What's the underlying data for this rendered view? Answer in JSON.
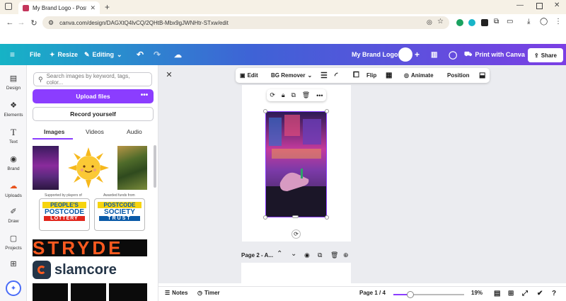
{
  "browser": {
    "tab_title": "My Brand Logo - Poster - Canva",
    "url": "canva.com/design/DAGXtQ4lvCQ/2QHtB-Mbx9gJWNHtr-STxw/edit"
  },
  "header": {
    "file": "File",
    "resize": "Resize",
    "editing": "Editing",
    "design_title": "My Brand Logo",
    "print": "Print with Canva",
    "share": "Share"
  },
  "rail": {
    "items": [
      {
        "label": "Design",
        "icon": "design-icon"
      },
      {
        "label": "Elements",
        "icon": "elements-icon"
      },
      {
        "label": "Text",
        "icon": "text-icon"
      },
      {
        "label": "Brand",
        "icon": "brand-icon"
      },
      {
        "label": "Uploads",
        "icon": "uploads-icon"
      },
      {
        "label": "Draw",
        "icon": "draw-icon"
      },
      {
        "label": "Projects",
        "icon": "projects-icon"
      },
      {
        "label": "",
        "icon": "apps-icon"
      }
    ]
  },
  "panel": {
    "search_placeholder": "Search images by keyword, tags, color...",
    "upload": "Upload files",
    "upload_more": "•••",
    "record": "Record yourself",
    "tabs": [
      "Images",
      "Videos",
      "Audio"
    ],
    "supported_caption": "Supported by players of",
    "awarded_caption": "Awarded funds from",
    "logo1_line1": "PEOPLE'S",
    "logo1_line2": "POSTCODE",
    "logo1_line3": "LOTTERY",
    "logo2_line1": "POSTCODE",
    "logo2_line2": "SOCIETY",
    "logo2_line3": "TRUST",
    "stryde": "STRYDE",
    "slamcore": "slamcore"
  },
  "toolbar": {
    "edit": "Edit",
    "bg_remover": "BG Remover",
    "flip": "Flip",
    "animate": "Animate",
    "position": "Position"
  },
  "canvas": {
    "page2_label": "Page 2 - A..."
  },
  "bottom": {
    "notes": "Notes",
    "timer": "Timer",
    "page": "Page 1 / 4",
    "zoom": "19%",
    "zoom_level": 0.19
  },
  "colors": {
    "accent": "#8b3dff",
    "header_start": "#16b3c6",
    "header_end": "#7b3fe4"
  }
}
